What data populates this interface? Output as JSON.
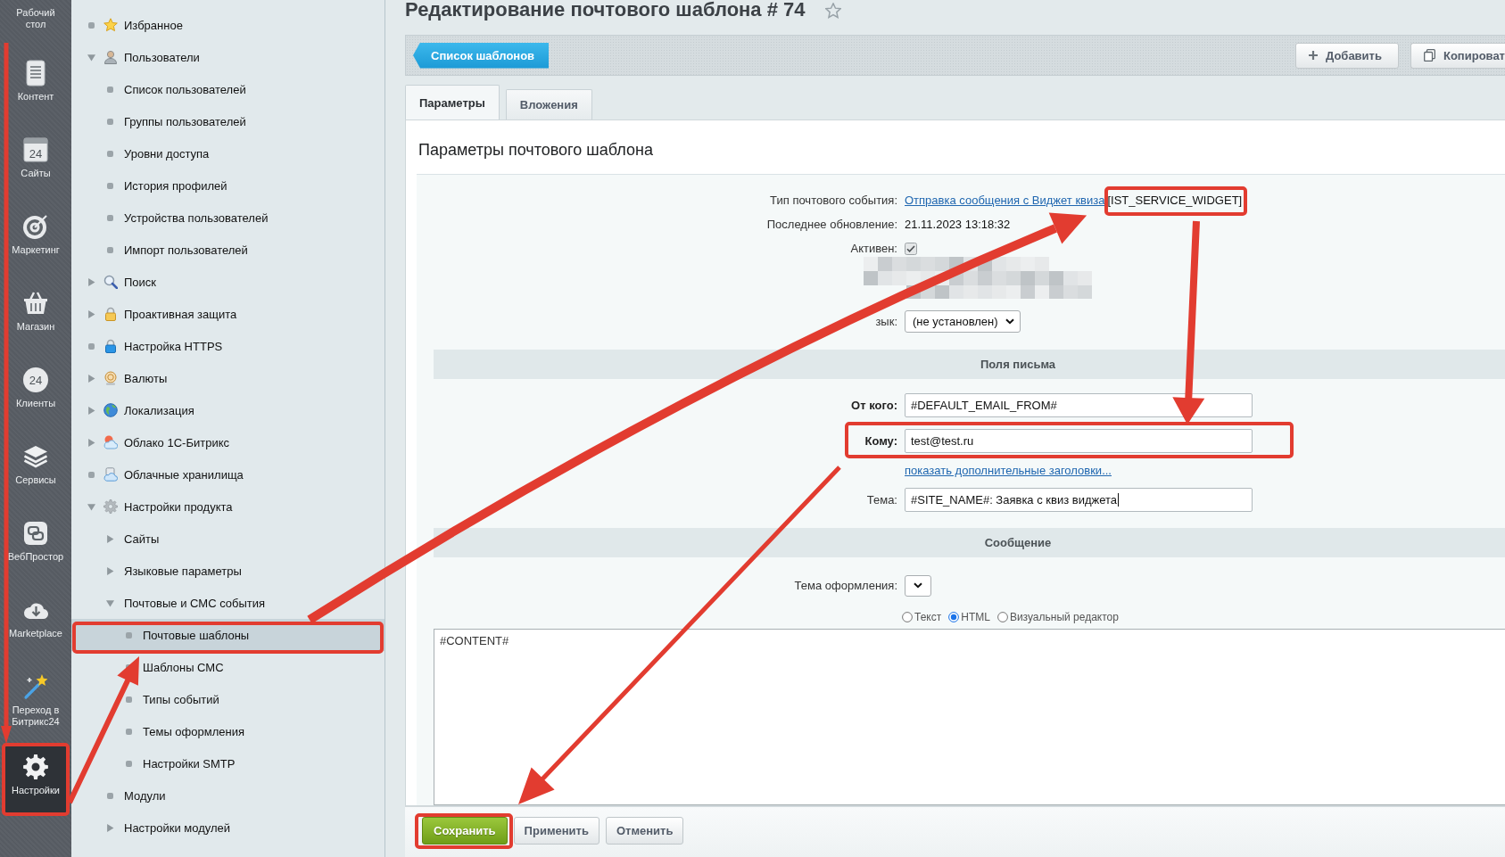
{
  "sidebar": {
    "items": [
      {
        "label": "Рабочий стол",
        "selected": false,
        "highlighted": false
      },
      {
        "label": "Контент",
        "selected": false,
        "highlighted": false
      },
      {
        "label": "Сайты",
        "icon_text": "24",
        "selected": false,
        "highlighted": false
      },
      {
        "label": "Маркетинг",
        "selected": false,
        "highlighted": false
      },
      {
        "label": "Магазин",
        "selected": false,
        "highlighted": false
      },
      {
        "label": "Клиенты",
        "icon_text": "24",
        "selected": false,
        "highlighted": false
      },
      {
        "label": "Сервисы",
        "selected": false,
        "highlighted": false
      },
      {
        "label": "ВебПростор",
        "selected": false,
        "highlighted": false
      },
      {
        "label": "Marketplace",
        "selected": false,
        "highlighted": false
      },
      {
        "label": "Переход в Битрикс24",
        "selected": false,
        "highlighted": false
      },
      {
        "label": "Настройки",
        "selected": true,
        "highlighted": true
      }
    ]
  },
  "menu_tree": {
    "items": [
      {
        "label": "Избранное",
        "kind": "page",
        "selected": false,
        "highlighted": false
      },
      {
        "label": "Пользователи",
        "kind": "folder",
        "expanded": true,
        "selected": false,
        "highlighted": false,
        "children": [
          {
            "label": "Список пользователей",
            "kind": "page",
            "selected": false,
            "highlighted": false
          },
          {
            "label": "Группы пользователей",
            "kind": "page",
            "selected": false,
            "highlighted": false
          },
          {
            "label": "Уровни доступа",
            "kind": "page",
            "selected": false,
            "highlighted": false
          },
          {
            "label": "История профилей",
            "kind": "page",
            "selected": false,
            "highlighted": false
          },
          {
            "label": "Устройства пользователей",
            "kind": "page",
            "selected": false,
            "highlighted": false
          },
          {
            "label": "Импорт пользователей",
            "kind": "page",
            "selected": false,
            "highlighted": false
          }
        ]
      },
      {
        "label": "Поиск",
        "kind": "folder",
        "expanded": false,
        "selected": false,
        "highlighted": false
      },
      {
        "label": "Проактивная защита",
        "kind": "folder",
        "expanded": false,
        "selected": false,
        "highlighted": false
      },
      {
        "label": "Настройка HTTPS",
        "kind": "page",
        "selected": false,
        "highlighted": false
      },
      {
        "label": "Валюты",
        "kind": "folder",
        "expanded": false,
        "selected": false,
        "highlighted": false
      },
      {
        "label": "Локализация",
        "kind": "folder",
        "expanded": false,
        "selected": false,
        "highlighted": false
      },
      {
        "label": "Облако 1С-Битрикс",
        "kind": "folder",
        "expanded": false,
        "selected": false,
        "highlighted": false
      },
      {
        "label": "Облачные хранилища",
        "kind": "page",
        "selected": false,
        "highlighted": false
      },
      {
        "label": "Настройки продукта",
        "kind": "folder",
        "expanded": true,
        "selected": false,
        "highlighted": false,
        "children": [
          {
            "label": "Сайты",
            "kind": "folder",
            "expanded": false,
            "selected": false,
            "highlighted": false
          },
          {
            "label": "Языковые параметры",
            "kind": "folder",
            "expanded": false,
            "selected": false,
            "highlighted": false
          },
          {
            "label": "Почтовые и СМС события",
            "kind": "folder",
            "expanded": true,
            "selected": false,
            "highlighted": false,
            "children": [
              {
                "label": "Почтовые шаблоны",
                "kind": "page",
                "selected": true,
                "highlighted": true
              },
              {
                "label": "Шаблоны СМС",
                "kind": "page",
                "selected": false,
                "highlighted": false
              },
              {
                "label": "Типы событий",
                "kind": "page",
                "selected": false,
                "highlighted": false
              },
              {
                "label": "Темы оформления",
                "kind": "page",
                "selected": false,
                "highlighted": false
              },
              {
                "label": "Настройки SMTP",
                "kind": "page",
                "selected": false,
                "highlighted": false
              }
            ]
          },
          {
            "label": "Модули",
            "kind": "page",
            "selected": false,
            "highlighted": false
          },
          {
            "label": "Настройки модулей",
            "kind": "folder",
            "expanded": false,
            "selected": false,
            "highlighted": false
          }
        ]
      }
    ]
  },
  "page": {
    "title": "Редактирование почтового шаблона # 74"
  },
  "toolbar": {
    "back_button": "Список шаблонов",
    "buttons": [
      "Добавить",
      "Копироват"
    ]
  },
  "tabs": [
    {
      "label": "Параметры",
      "selected": true
    },
    {
      "label": "Вложения",
      "selected": false
    }
  ],
  "form": {
    "heading": "Параметры почтового шаблона",
    "rows": [
      {
        "kind": "link",
        "label": "Тип почтового события:",
        "value": "Отправка сообщения с Виджет квиза",
        "suffix": "[IST_SERVICE_WIDGET]",
        "highlighted": true
      },
      {
        "kind": "text",
        "label": "Последнее обновление:",
        "value": "21.11.2023 13:18:32"
      },
      {
        "kind": "checkbox",
        "label": "Активен:",
        "checked": true
      },
      {
        "kind": "pixelated"
      },
      {
        "kind": "select",
        "label": "зык:",
        "value": "(не установлен)"
      },
      {
        "kind": "section",
        "label": "Поля письма"
      },
      {
        "kind": "input",
        "label": "От кого:",
        "value": "#DEFAULT_EMAIL_FROM#",
        "required": true,
        "focused": false,
        "highlighted": false
      },
      {
        "kind": "input",
        "label": "Кому:",
        "value": "test@test.ru",
        "required": true,
        "focused": false,
        "highlighted": true
      },
      {
        "kind": "action_link",
        "value": "показать дополнительные заголовки..."
      },
      {
        "kind": "input",
        "label": "Тема:",
        "value": "#SITE_NAME#: Заявка с квиз виджета",
        "required": false,
        "focused": true,
        "highlighted": false
      },
      {
        "kind": "section",
        "label": "Сообщение"
      },
      {
        "kind": "select",
        "label": "Тема оформления:"
      },
      {
        "kind": "radios",
        "options": [
          {
            "label": "Текст",
            "selected": false
          },
          {
            "label": "HTML",
            "selected": true
          },
          {
            "label": "Визуальный редактор",
            "selected": false
          }
        ]
      },
      {
        "kind": "textarea",
        "value": "#CONTENT#"
      }
    ]
  },
  "footer": {
    "buttons": [
      {
        "label": "Сохранить",
        "kind": "primary",
        "highlighted": true
      },
      {
        "label": "Применить",
        "kind": "default",
        "highlighted": false
      },
      {
        "label": "Отменить",
        "kind": "default",
        "highlighted": false
      }
    ]
  }
}
